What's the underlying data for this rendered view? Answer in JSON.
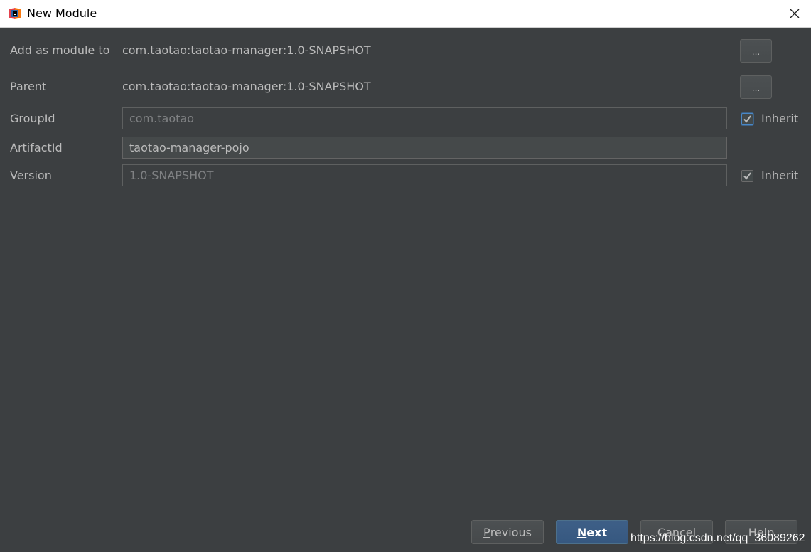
{
  "window": {
    "title": "New Module",
    "icon": "intellij-icon",
    "close_icon": "close-icon"
  },
  "form": {
    "add_as_module": {
      "label": "Add as module to",
      "value": "com.taotao:taotao-manager:1.0-SNAPSHOT",
      "browse_label": "..."
    },
    "parent": {
      "label": "Parent",
      "value": "com.taotao:taotao-manager:1.0-SNAPSHOT",
      "browse_label": "..."
    },
    "group_id": {
      "label": "GroupId",
      "value": "com.taotao",
      "inherit_label": "Inherit",
      "inherit_checked": true
    },
    "artifact_id": {
      "label": "ArtifactId",
      "value": "taotao-manager-pojo"
    },
    "version": {
      "label": "Version",
      "value": "1.0-SNAPSHOT",
      "inherit_label": "Inherit",
      "inherit_checked": true
    }
  },
  "buttons": {
    "previous": {
      "mnemonic": "P",
      "rest": "revious"
    },
    "next": {
      "mnemonic": "N",
      "rest": "ext"
    },
    "cancel": "Cancel",
    "help": "Help"
  },
  "watermark": "https://blog.csdn.net/qq_36089262",
  "colors": {
    "background": "#3c3f41",
    "text": "#bbbbbb",
    "primary_button": "#365880",
    "focus": "#4a88c7"
  }
}
